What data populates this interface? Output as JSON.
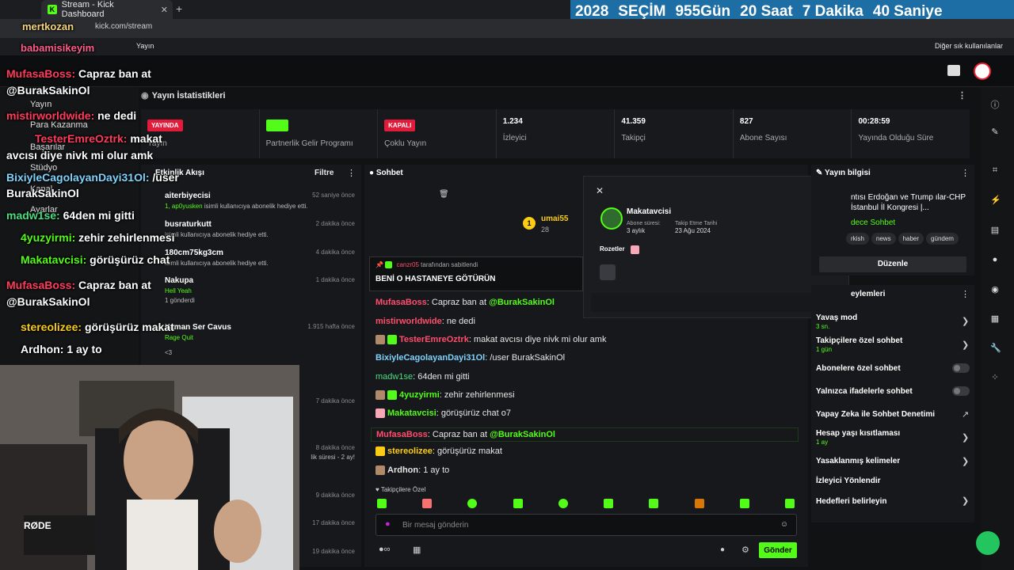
{
  "browser": {
    "tab_title": "Stream - Kick Dashboard",
    "url": "kick.com/stream",
    "bookmark_folder": "Yayın",
    "other_bookmarks": "Diğer sık kullanılanlar"
  },
  "countdown": {
    "year": "2028",
    "label": "SEÇİM",
    "days": "955",
    "days_unit": "Gün",
    "hours": "20",
    "hours_unit": "Saat",
    "minutes": "7",
    "minutes_unit": "Dakika",
    "seconds": "40",
    "seconds_unit": "Saniye"
  },
  "nav": {
    "items": [
      "Yayın",
      "Para Kazanma",
      "Başarılar",
      "Stüdyo",
      "Kanal",
      "Ayarlar"
    ]
  },
  "stats": {
    "title": "Yayın İstatistikleri",
    "live_badge": "YAYINDA",
    "live_label": "Yayın",
    "partner_label": "Partnerlik Gelir Programı",
    "multi_badge": "KAPALI",
    "multi_label": "Çoklu Yayın",
    "viewers": "1.234",
    "viewers_label": "İzleyici",
    "followers": "41.359",
    "followers_label": "Takipçi",
    "subs": "827",
    "subs_label": "Abone Sayısı",
    "duration": "00:28:59",
    "duration_label": "Yayında Olduğu Süre"
  },
  "activity": {
    "title": "Etkinlik Akışı",
    "filter": "Filtre",
    "rows": [
      {
        "name": "aiterbiyecisi",
        "sub_highlight": "1, ap0yusken",
        "sub": "isimli kullanıcıya abonelik hediye etti.",
        "time": "52 saniye önce"
      },
      {
        "name": "busraturkutt",
        "sub_highlight": "",
        "sub": "isimli kullanıcıya abonelik hediye etti.",
        "time": "2 dakika önce"
      },
      {
        "name": "180cm75kg3cm",
        "sub_highlight": "",
        "sub": "isimli kullanıcıya abonelik hediye etti.",
        "time": "4 dakika önce"
      },
      {
        "name": "Nakupa",
        "sub_highlight": "Hell Yeah",
        "sub": "1 gönderdi",
        "time": "1 dakika önce"
      },
      {
        "name": "Yaman Ser Cavus",
        "sub_highlight": "Rage Quit",
        "sub": "<3",
        "time": "1.915 hafta önce"
      },
      {
        "name": "",
        "sub_highlight": "",
        "sub": "",
        "time": "7 dakika önce"
      },
      {
        "name": "",
        "sub_highlight": "",
        "sub": "lik süresi - 2 ay!",
        "time": "8 dakika önce"
      },
      {
        "name": "",
        "sub_highlight": "",
        "sub": "",
        "time": "9 dakika önce"
      },
      {
        "name": "",
        "sub_highlight": "",
        "sub": "",
        "time": "17 dakika önce"
      },
      {
        "name": "",
        "sub_highlight": "",
        "sub": "",
        "time": "19 dakika önce"
      }
    ]
  },
  "chat": {
    "title": "Sohbet",
    "top_user": "umai55",
    "top_user_count": "28",
    "pinned_by": "canzr05",
    "pinned_by_suffix": "tarafından sabitlendi",
    "pinned_text": "BENİ O HASTANEYE GÖTÜRÜN",
    "messages": [
      {
        "user": "MufasaBoss",
        "color": "#ff4d6d",
        "text": "Capraz ban at",
        "mention": "@BurakSakinOl"
      },
      {
        "user": "mistirworldwide",
        "color": "#ff4d6d",
        "text": "ne dedi",
        "mention": ""
      },
      {
        "user": "TesterEmreOztrk",
        "color": "#ff4d6d",
        "text": "makat avcısı diye nivk mi olur amk",
        "mention": ""
      },
      {
        "user": "BixiyleCagolayanDayi31Ol",
        "color": "#7dd3fc",
        "text": "/user BurakSakinOl",
        "mention": ""
      },
      {
        "user": "madw1se",
        "color": "#4ade80",
        "text": "64den mi gitti",
        "mention": ""
      },
      {
        "user": "4yuzyirmi",
        "color": "#53fc18",
        "text": "zehir zehirlenmesi",
        "mention": ""
      },
      {
        "user": "Makatavcisi",
        "color": "#53fc18",
        "text": "görüşürüz chat o7",
        "mention": ""
      },
      {
        "user": "MufasaBoss",
        "color": "#ff4d6d",
        "text": "Capraz ban at",
        "mention": "@BurakSakinOl"
      },
      {
        "user": "stereolizee",
        "color": "#facc15",
        "text": "görüşürüz makat",
        "mention": ""
      },
      {
        "user": "Ardhon",
        "color": "#e5e5e5",
        "text": "1 ay to",
        "mention": ""
      }
    ],
    "followers_only_label": "Takipçilere Özel",
    "input_placeholder": "Bir mesaj gönderin",
    "send_label": "Gönder"
  },
  "usercard": {
    "username": "Makatavcisi",
    "sub_duration_label": "Abone süresi:",
    "sub_duration": "3 aylık",
    "follow_date_label": "Takip Etme Tarihi",
    "follow_date": "23 Ağu 2024",
    "badges_label": "Rozetler"
  },
  "streaminfo": {
    "title": "Yayın bilgisi",
    "stream_title": "ntısı Erdoğan ve Trump ılar-CHP İstanbul İl Kongresi |...",
    "category": "dece Sohbet",
    "tags": [
      "rkish",
      "news",
      "haber",
      "gündem"
    ],
    "edit_label": "Düzenle"
  },
  "chat_actions": {
    "title": "eylemleri",
    "slow_mode": "Yavaş mod",
    "slow_mode_value": "3 sn.",
    "followers_chat": "Takipçilere özel sohbet",
    "followers_chat_value": "1 gün",
    "subs_chat": "Abonelere özel sohbet",
    "emotes_chat": "Yalnızca ifadelerle sohbet",
    "ai_moderation": "Yapay Zeka ile Sohbet Denetimi",
    "age_restriction": "Hesap yaşı kısıtlaması",
    "age_value": "1 ay",
    "banned_words": "Yasaklanmış kelimeler",
    "redirect": "İzleyici Yönlendir",
    "goals": "Hedefleri belirleyin"
  },
  "overlay": {
    "header_user1": "mertkozan",
    "header_user2": "babamisikeyim",
    "lines": [
      {
        "user": "MufasaBoss:",
        "color": "#ff3b5c",
        "text": "Capraz ban at"
      },
      {
        "user": "",
        "color": "#ffffff",
        "text": "@BurakSakinOl"
      },
      {
        "user": "mistirworldwide:",
        "color": "#ff3b5c",
        "text": "ne dedi"
      },
      {
        "user": "TesterEmreOztrk:",
        "color": "#ff3b5c",
        "text": "makat"
      },
      {
        "user": "",
        "color": "#ffffff",
        "text": "avcısı diye nivk mi olur amk"
      },
      {
        "user": "BixiyleCagolayanDayi31Ol:",
        "color": "#7dd3fc",
        "text": "/user"
      },
      {
        "user": "",
        "color": "#ffffff",
        "text": "BurakSakinOl"
      },
      {
        "user": "madw1se:",
        "color": "#4ade80",
        "text": "64den mi gitti"
      },
      {
        "user": "4yuzyirmi:",
        "color": "#53fc18",
        "text": "zehir zehirlenmesi"
      },
      {
        "user": "Makatavcisi:",
        "color": "#53fc18",
        "text": "görüşürüz chat"
      },
      {
        "user": "MufasaBoss:",
        "color": "#ff3b5c",
        "text": "Capraz ban at"
      },
      {
        "user": "",
        "color": "#ffffff",
        "text": "@BurakSakinOl"
      },
      {
        "user": "stereolizee:",
        "color": "#facc15",
        "text": "görüşürüz makat"
      },
      {
        "user": "Ardhon:",
        "color": "#ffffff",
        "text": "1 ay to"
      }
    ],
    "mic_label": "RØDE"
  },
  "colors": {
    "accent": "#53fc18",
    "live_red": "#e31b3b",
    "countdown_bg": "#1e6ea6"
  }
}
